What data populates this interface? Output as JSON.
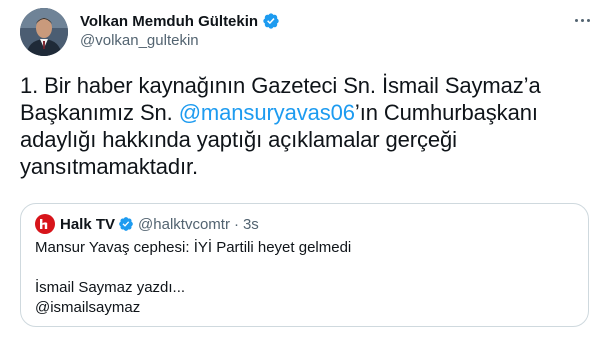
{
  "author": {
    "name": "Volkan Memduh Gültekin",
    "handle": "@volkan_gultekin",
    "verified": true
  },
  "tweet": {
    "text_before_mention": "1. Bir haber kaynağının Gazeteci Sn. İsmail Saymaz’a Başkanımız Sn. ",
    "mention": "@mansuryavas06",
    "text_after_mention": "’ın Cumhurbaşkanı adaylığı hakkında yaptığı açıklamalar gerçeği yansıtmamaktadır."
  },
  "quoted_tweet": {
    "name": "Halk TV",
    "handle": "@halktvcomtr",
    "separator": "·",
    "time": "3s",
    "verified": true,
    "lines": [
      "Mansur Yavaş cephesi: İYİ Partili heyet gelmedi",
      "İsmail Saymaz yazdı...",
      "@ismailsaymaz"
    ]
  },
  "icons": {
    "verified": "verified-badge-icon",
    "more": "more-options-icon"
  },
  "colors": {
    "accent": "#1d9bf0",
    "text": "#0f1419",
    "secondary_text": "#536471",
    "border": "#cfd9de",
    "halktv_red": "#d7141a"
  }
}
